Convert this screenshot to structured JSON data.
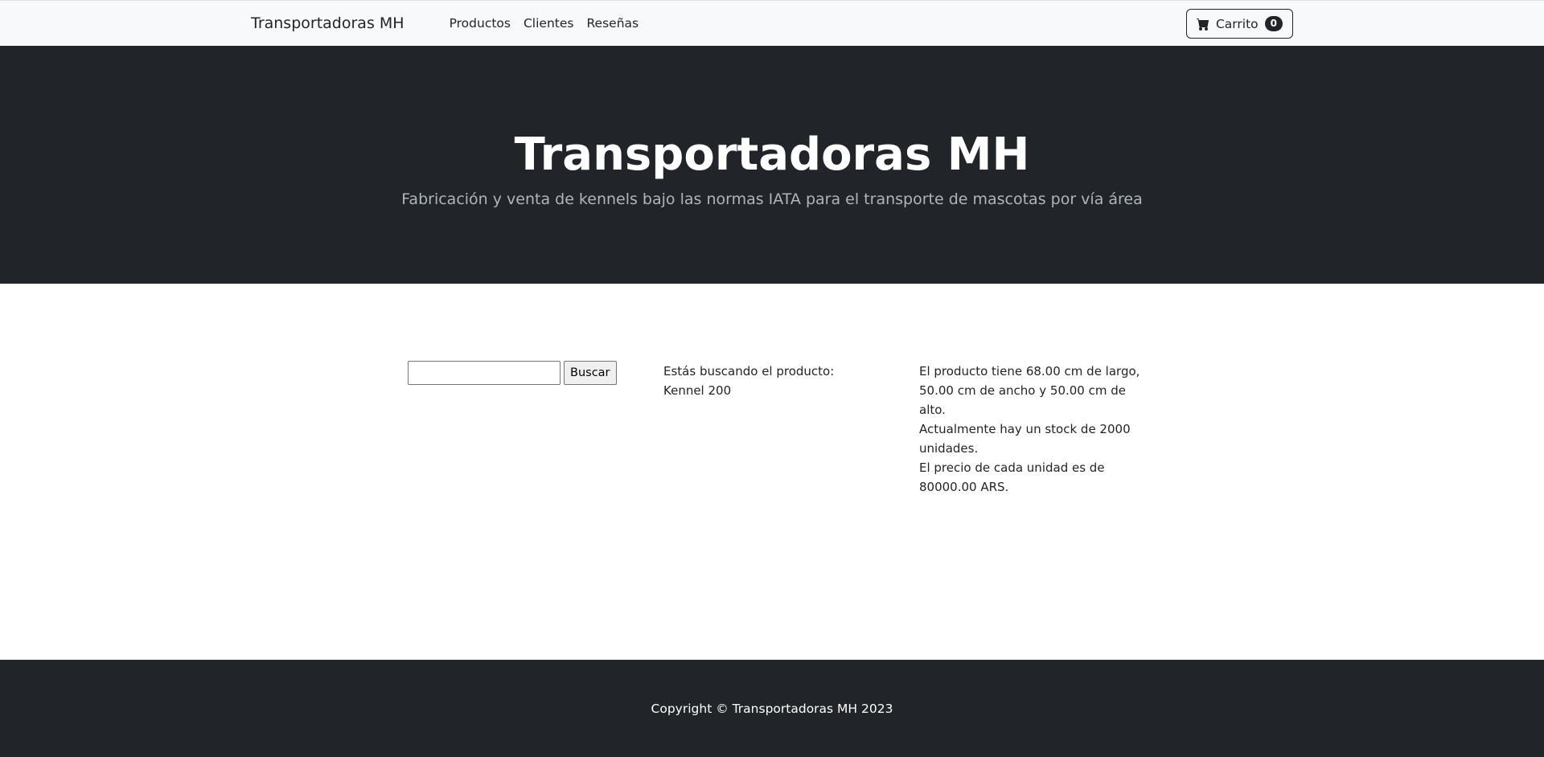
{
  "navbar": {
    "brand": "Transportadoras MH",
    "links": [
      "Productos",
      "Clientes",
      "Reseñas"
    ],
    "cart": {
      "label": "Carrito",
      "count": "0"
    }
  },
  "hero": {
    "title": "Transportadoras MH",
    "subtitle": "Fabricación y venta de kennels bajo las normas IATA para el transporte de mascotas por vía área"
  },
  "search": {
    "input_value": "",
    "button_label": "Buscar"
  },
  "result": {
    "searching": "Estás buscando el producto: Kennel 200",
    "details": [
      "El producto tiene 68.00 cm de largo, 50.00 cm de ancho y 50.00 cm de alto.",
      "Actualmente hay un stock de 2000 unidades.",
      "El precio de cada unidad es de 80000.00 ARS."
    ]
  },
  "footer": {
    "copyright": "Copyright © Transportadoras MH 2023"
  }
}
